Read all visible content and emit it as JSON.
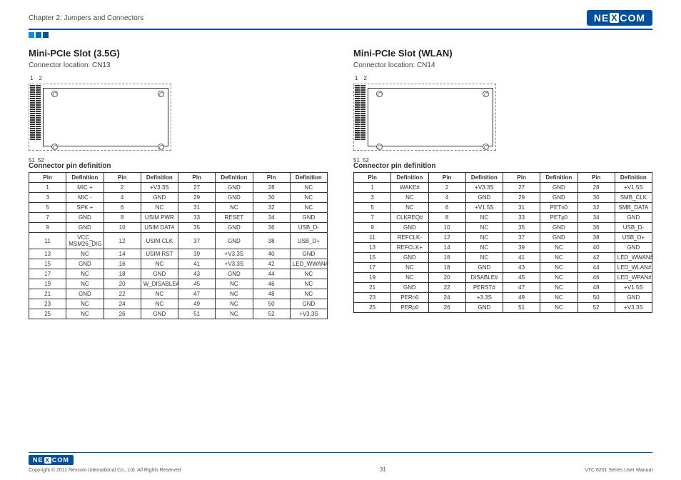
{
  "header": {
    "chapter": "Chapter 2: Jumpers and Connectors",
    "logo_text_pre": "NE",
    "logo_text_mid": "X",
    "logo_text_post": "COM"
  },
  "left": {
    "title": "Mini-PCIe Slot (3.5G)",
    "location": "Connector location: CN13",
    "pin_top_1": "1",
    "pin_top_2": "2",
    "pin_bot_1": "51",
    "pin_bot_2": "52",
    "table_title": "Connector pin definition",
    "headers": [
      "Pin",
      "Definition",
      "Pin",
      "Definition",
      "Pin",
      "Definition",
      "Pin",
      "Definition"
    ],
    "rows": [
      [
        "1",
        "MIC +",
        "2",
        "+V3.3S",
        "27",
        "GND",
        "28",
        "NC"
      ],
      [
        "3",
        "MIC -",
        "4",
        "GND",
        "29",
        "GND",
        "30",
        "NC"
      ],
      [
        "5",
        "SPK +",
        "6",
        "NC",
        "31",
        "NC",
        "32",
        "NC"
      ],
      [
        "7",
        "GND",
        "8",
        "USIM PWR",
        "33",
        "RESET",
        "34",
        "GND"
      ],
      [
        "9",
        "GND",
        "10",
        "USIM DATA",
        "35",
        "GND",
        "36",
        "USB_D-"
      ],
      [
        "11",
        "VCC_ MSM26_DIG",
        "12",
        "USIM CLK",
        "37",
        "GND",
        "38",
        "USB_D+"
      ],
      [
        "13",
        "NC",
        "14",
        "USIM RST",
        "39",
        "+V3.3S",
        "40",
        "GND"
      ],
      [
        "15",
        "GND",
        "16",
        "NC",
        "41",
        "+V3.3S",
        "42",
        "LED_WWAN#"
      ],
      [
        "17",
        "NC",
        "18",
        "GND",
        "43",
        "GND",
        "44",
        "NC"
      ],
      [
        "19",
        "NC",
        "20",
        "W_DISABLE#",
        "45",
        "NC",
        "46",
        "NC"
      ],
      [
        "21",
        "GND",
        "22",
        "NC",
        "47",
        "NC",
        "48",
        "NC"
      ],
      [
        "23",
        "NC",
        "24",
        "NC",
        "49",
        "NC",
        "50",
        "GND"
      ],
      [
        "25",
        "NC",
        "26",
        "GND",
        "51",
        "NC",
        "52",
        "+V3.3S"
      ]
    ]
  },
  "right": {
    "title": "Mini-PCIe Slot (WLAN)",
    "location": "Connector location: CN14",
    "pin_top_1": "1",
    "pin_top_2": "2",
    "pin_bot_1": "51",
    "pin_bot_2": "52",
    "table_title": "Connector pin definition",
    "headers": [
      "Pin",
      "Definition",
      "Pin",
      "Definition",
      "Pin",
      "Definition",
      "Pin",
      "Definition"
    ],
    "rows": [
      [
        "1",
        "WAKE#",
        "2",
        "+V3.3S",
        "27",
        "GND",
        "28",
        "+V1.5S"
      ],
      [
        "3",
        "NC",
        "4",
        "GND",
        "29",
        "GND",
        "30",
        "SMB_CLK"
      ],
      [
        "5",
        "NC",
        "6",
        "+V1.5S",
        "31",
        "PETn0",
        "32",
        "SMB_DATA"
      ],
      [
        "7",
        "CLKREQ#",
        "8",
        "NC",
        "33",
        "PETp0",
        "34",
        "GND"
      ],
      [
        "9",
        "GND",
        "10",
        "NC",
        "35",
        "GND",
        "36",
        "USB_D-"
      ],
      [
        "11",
        "REFCLK-",
        "12",
        "NC",
        "37",
        "GND",
        "38",
        "USB_D+"
      ],
      [
        "13",
        "REFCLK+",
        "14",
        "NC",
        "39",
        "NC",
        "40",
        "GND"
      ],
      [
        "15",
        "GND",
        "16",
        "NC",
        "41",
        "NC",
        "42",
        "LED_WWAN#"
      ],
      [
        "17",
        "NC",
        "18",
        "GND",
        "43",
        "NC",
        "44",
        "LED_WLAN#"
      ],
      [
        "19",
        "NC",
        "20",
        "DISABLE#",
        "45",
        "NC",
        "46",
        "LED_WPAN#"
      ],
      [
        "21",
        "GND",
        "22",
        "PERST#",
        "47",
        "NC",
        "48",
        "+V1.5S"
      ],
      [
        "23",
        "PERn0",
        "24",
        "+3.3S",
        "49",
        "NC",
        "50",
        "GND"
      ],
      [
        "25",
        "PERp0",
        "26",
        "GND",
        "51",
        "NC",
        "52",
        "+V3.3S"
      ]
    ]
  },
  "footer": {
    "copyright": "Copyright © 2011 Nexcom International Co., Ltd. All Rights Reserved",
    "page": "31",
    "manual": "VTC 6201 Series User Manual"
  }
}
